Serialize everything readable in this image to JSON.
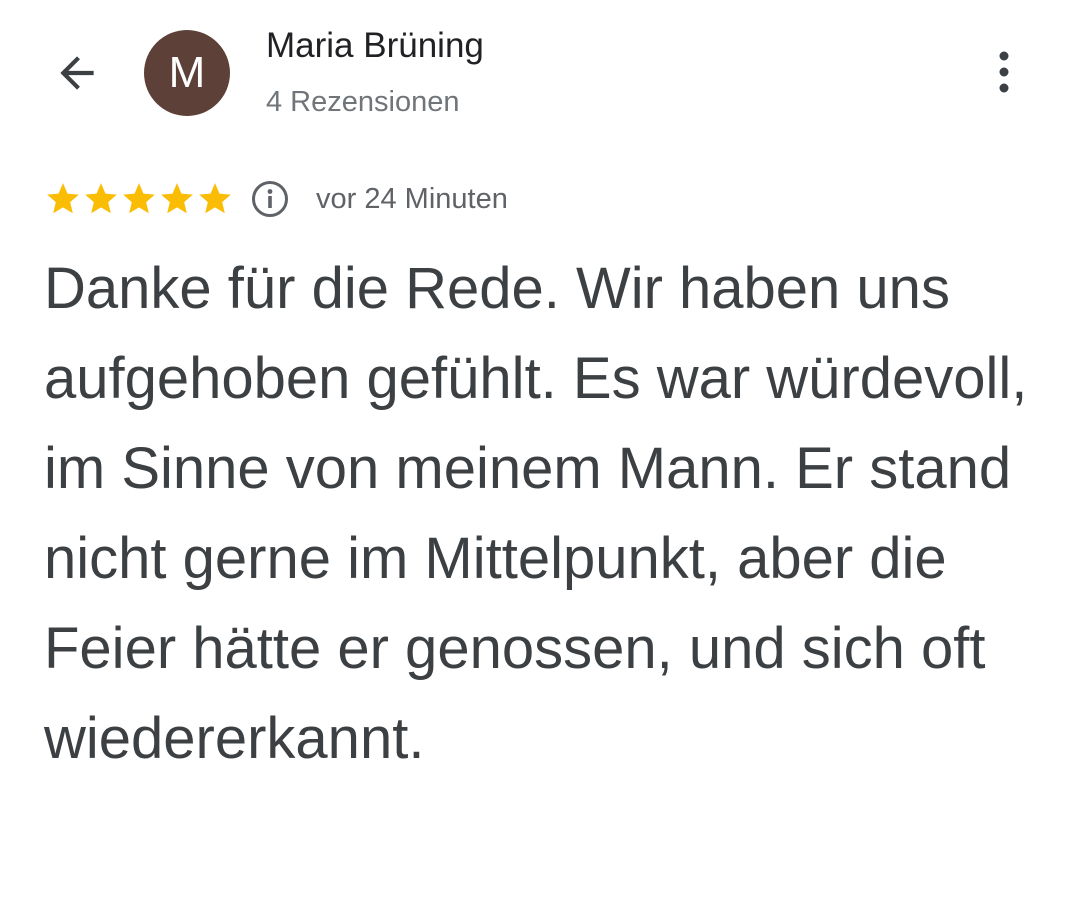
{
  "header": {
    "avatar_letter": "M",
    "avatar_color": "#5d4037",
    "name": "Maria Brüning",
    "review_count": "4 Rezensionen",
    "back_icon": "arrow-back-icon",
    "more_icon": "more-vert-icon"
  },
  "review": {
    "rating": 5,
    "rating_max": 5,
    "star_color": "#fbbc04",
    "info_icon": "info-icon",
    "time": "vor 24 Minuten",
    "text": "Danke für die Rede. Wir haben uns aufgehoben gefühlt. Es war würdevoll, im Sinne von meinem Mann. Er stand nicht gerne im Mittelpunkt, aber die Feier hätte er genossen, und sich oft wiedererkannt."
  }
}
